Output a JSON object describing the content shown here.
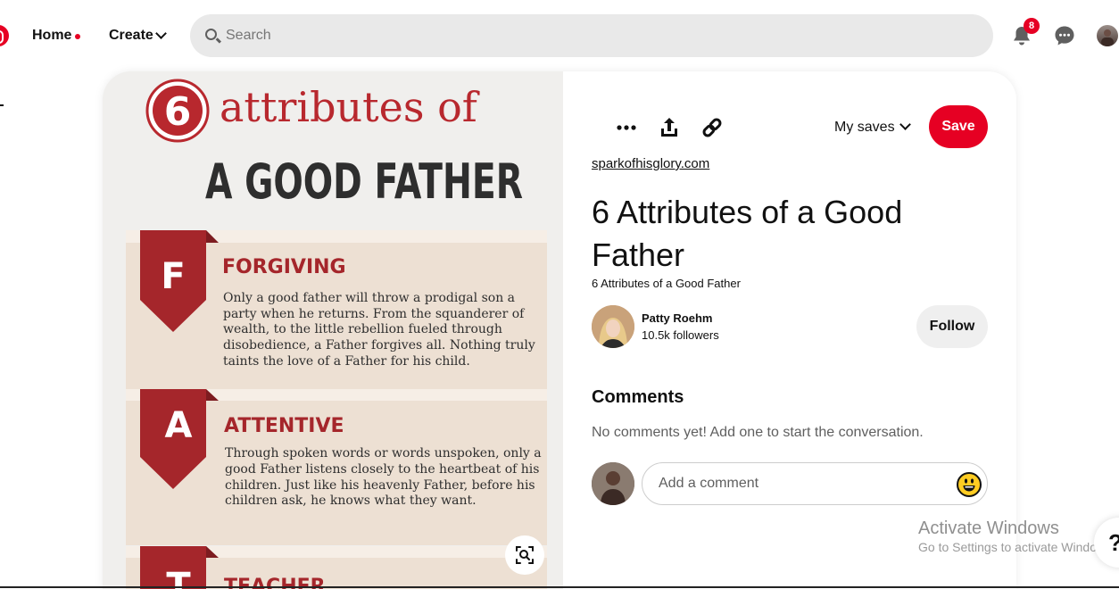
{
  "header": {
    "home_label": "Home",
    "create_label": "Create",
    "search_placeholder": "Search",
    "notification_count": "8",
    "brand_color": "#e60023"
  },
  "pin": {
    "image": {
      "title_number": "6",
      "title_top": "attributes of",
      "title_bottom": "A GOOD FATHER",
      "sections": [
        {
          "letter": "F",
          "heading": "FORGIVING",
          "lines": [
            "Only a good father will throw a prodigal son a",
            "party when he returns. From the squanderer of",
            "wealth, to the little rebellion fueled through",
            "disobedience, a Father forgives all. Nothing truly",
            "taints the love of a Father for his child."
          ]
        },
        {
          "letter": "A",
          "heading": "ATTENTIVE",
          "lines": [
            "Through spoken words or words unspoken, only a",
            "good Father listens closely to the heartbeat of his",
            "children. Just like his heavenly Father, before his",
            "children ask, he knows what they want."
          ]
        },
        {
          "letter": "T",
          "heading": "TEACHER",
          "lines": []
        }
      ],
      "accent_color": "#a5262b",
      "panel_color": "#ede0d3"
    },
    "actions": {
      "more_icon": "more-icon",
      "share_icon": "share-icon",
      "link_icon": "link-icon",
      "board_label": "My saves",
      "save_label": "Save"
    },
    "source": "sparkofhisglory.com",
    "title": "6 Attributes of a Good Father",
    "description": "6 Attributes of a Good Father",
    "creator": {
      "name": "Patty Roehm",
      "followers": "10.5k followers",
      "follow_label": "Follow"
    },
    "comments": {
      "heading": "Comments",
      "empty_text": "No comments yet! Add one to start the conversation.",
      "input_placeholder": "Add a comment"
    }
  },
  "system": {
    "watermark_title": "Activate Windows",
    "watermark_sub": "Go to Settings to activate Windows.",
    "help_label": "?"
  }
}
